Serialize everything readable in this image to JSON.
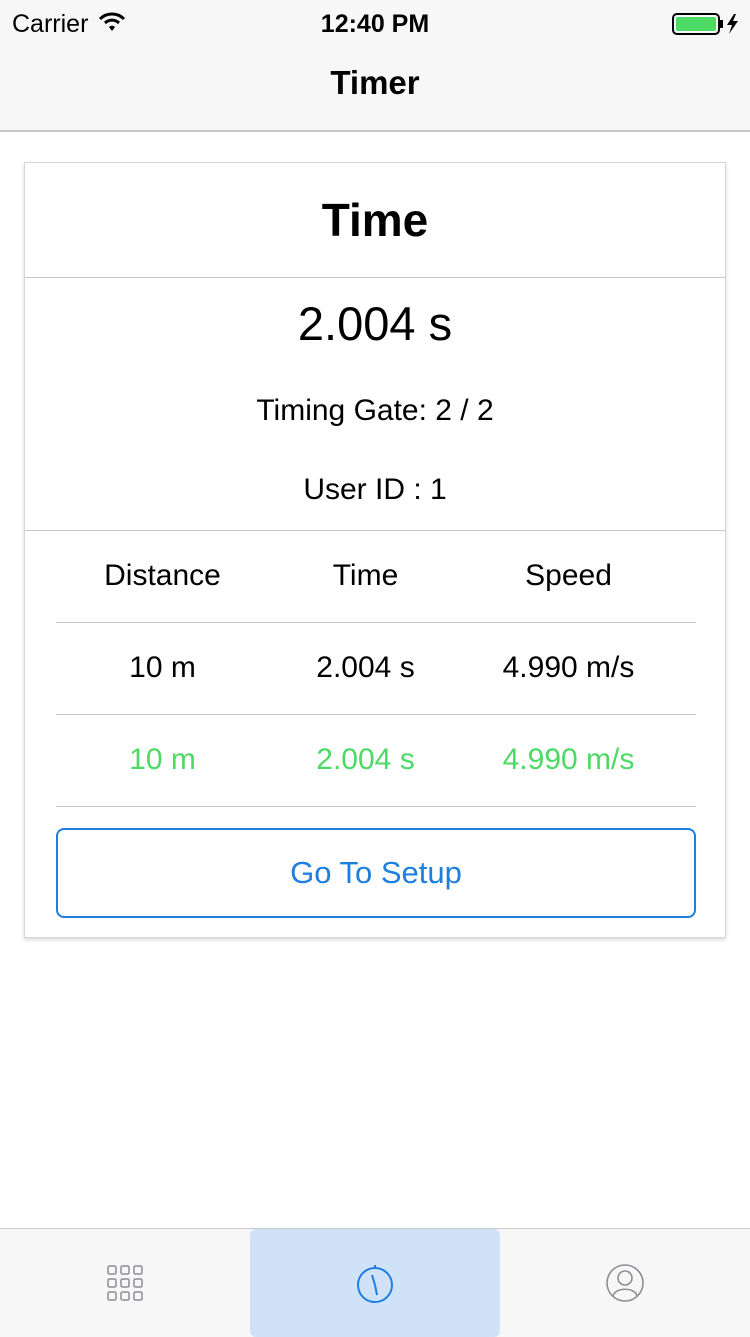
{
  "status_bar": {
    "carrier": "Carrier",
    "time": "12:40 PM",
    "wifi_icon": "wifi-icon",
    "battery_icon": "battery-icon"
  },
  "nav": {
    "title": "Timer"
  },
  "card": {
    "title": "Time",
    "total_time": "2.004 s",
    "timing_gate": "Timing Gate: 2 / 2",
    "user_id": "User ID : 1",
    "table": {
      "headers": [
        "Distance",
        "Time",
        "Speed"
      ],
      "rows": [
        {
          "distance": "10 m",
          "time": "2.004 s",
          "speed": "4.990 m/s",
          "color": "#000000"
        },
        {
          "distance": "10 m",
          "time": "2.004 s",
          "speed": "4.990 m/s",
          "color": "#4cd964"
        }
      ]
    },
    "setup_button": "Go To Setup"
  },
  "tab_bar": {
    "tabs": [
      {
        "icon": "grid-icon",
        "active": false
      },
      {
        "icon": "stopwatch-icon",
        "active": true
      },
      {
        "icon": "profile-icon",
        "active": false
      }
    ]
  },
  "colors": {
    "accent": "#1d7fe0",
    "success": "#4cd964",
    "tab_active_bg": "#cfe2f8"
  }
}
